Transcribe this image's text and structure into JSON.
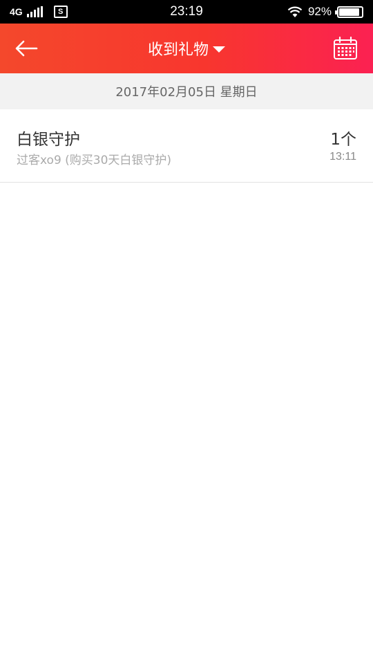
{
  "status_bar": {
    "network": "4G",
    "sim_label": "S",
    "time": "23:19",
    "battery_percent": "92%",
    "battery_level": 0.92
  },
  "header": {
    "title": "收到礼物",
    "back_icon": "arrow-left-icon",
    "calendar_icon": "calendar-icon",
    "gradient_colors": [
      "#f4482c",
      "#fb2152"
    ]
  },
  "date_band": {
    "date": "2017年02月05日 星期日"
  },
  "gifts": [
    {
      "name": "白银守护",
      "sender_info": "过客xo9 (购买30天白银守护)",
      "count": "1个",
      "time": "13:11"
    }
  ]
}
